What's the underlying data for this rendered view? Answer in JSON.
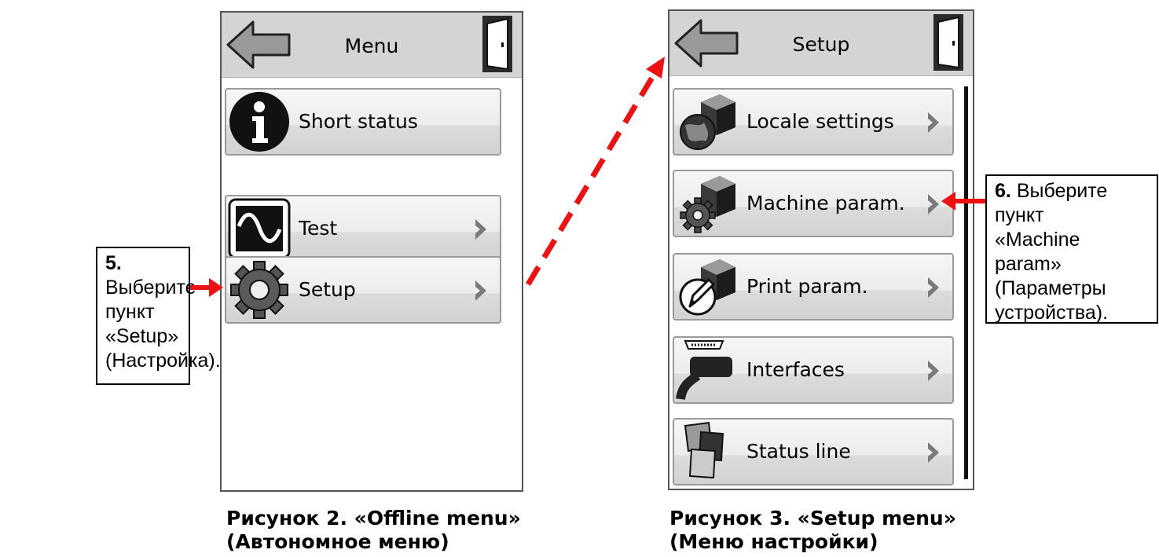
{
  "screen1": {
    "title": "Menu",
    "items": [
      {
        "label": "Short status",
        "icon": "info-icon",
        "chevron": false
      },
      {
        "label": "Test",
        "icon": "waveform-icon",
        "chevron": true
      },
      {
        "label": "Setup",
        "icon": "gear-icon",
        "chevron": true
      }
    ]
  },
  "screen2": {
    "title": "Setup",
    "items": [
      {
        "label": "Locale settings",
        "icon": "globe-printer-icon",
        "chevron": true
      },
      {
        "label": "Machine param.",
        "icon": "gear-printer-icon",
        "chevron": true
      },
      {
        "label": "Print param.",
        "icon": "pen-printer-icon",
        "chevron": true
      },
      {
        "label": "Interfaces",
        "icon": "cable-icon",
        "chevron": true
      },
      {
        "label": "Status line",
        "icon": "cards-icon",
        "chevron": true
      }
    ]
  },
  "callout5": {
    "step": "5.",
    "lines": [
      "Выберите",
      "пункт",
      "«Setup»",
      "(Настройка)."
    ]
  },
  "callout6": {
    "step": "6.",
    "lines": [
      "Выберите",
      "пункт",
      "«Machine",
      "param»",
      "(Параметры",
      "устройства)."
    ]
  },
  "captions": {
    "fig2_line1": "Рисунок 2. «Offline menu»",
    "fig2_line2": "(Автономное меню)",
    "fig3_line1": "Рисунок 3. «Setup menu»",
    "fig3_line2": "(Меню настройки)"
  },
  "colors": {
    "arrow": "#ee1111",
    "titlebar": "#d4d4d4",
    "frame": "#555555"
  }
}
